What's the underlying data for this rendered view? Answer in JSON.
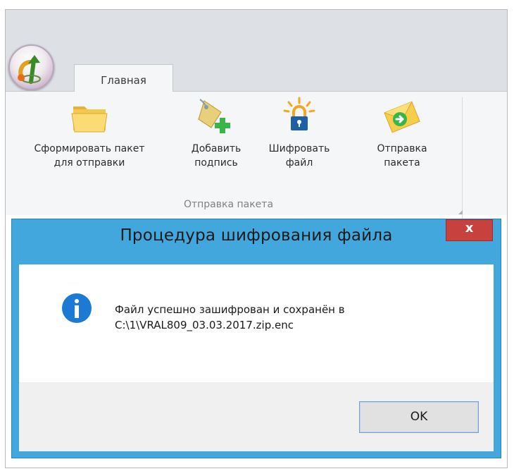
{
  "ribbon": {
    "tab_label": "Главная",
    "group_label": "Отправка пакета",
    "buttons": [
      {
        "label": "Сформировать пакет\nдля отправки",
        "icon": "folder-icon"
      },
      {
        "label": "Добавить\nподпись",
        "icon": "tag-add-icon"
      },
      {
        "label": "Шифровать\nфайл",
        "icon": "lock-icon"
      },
      {
        "label": "Отправка\nпакета",
        "icon": "mail-send-icon"
      }
    ]
  },
  "dialog": {
    "title": "Процедура шифрования файла",
    "close_label": "x",
    "message_line1": "Файл успешно зашифрован и сохранён в",
    "message_line2": "C:\\1\\VRAL809_03.03.2017.zip.enc",
    "ok_label": "OK",
    "icon": "info-icon"
  },
  "colors": {
    "dialog_frame": "#42a7dc",
    "close_button": "#c7423e",
    "info_icon": "#1c79d4"
  }
}
